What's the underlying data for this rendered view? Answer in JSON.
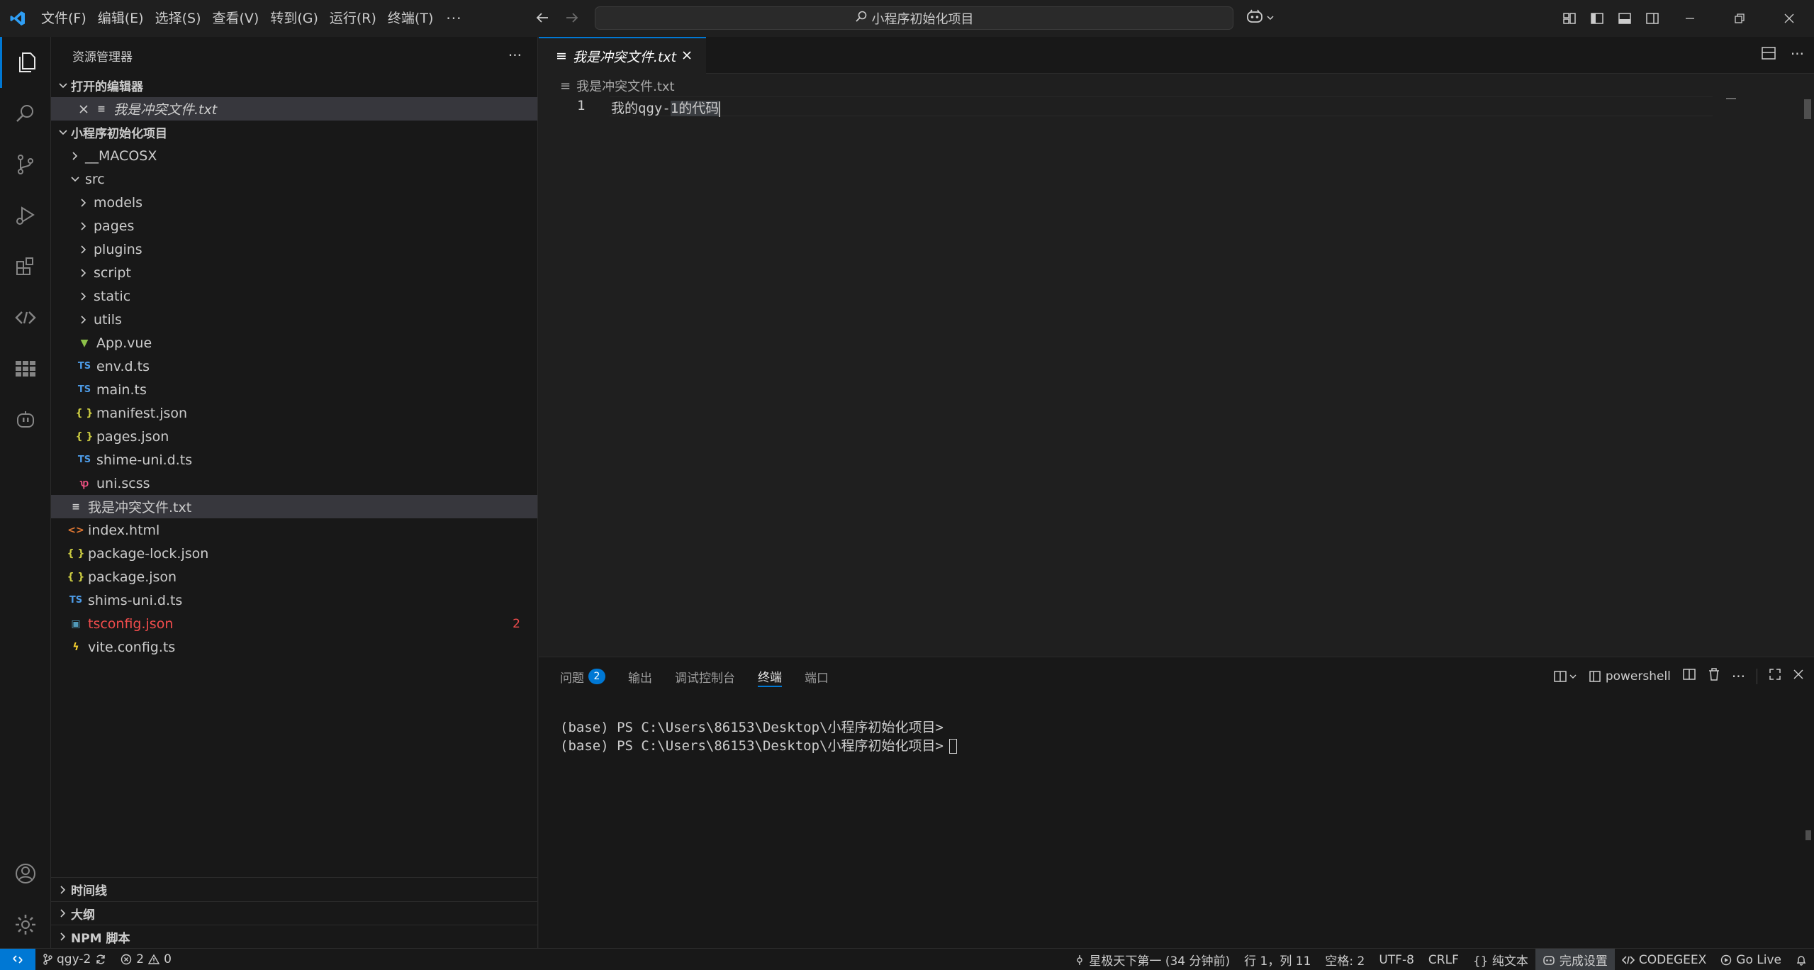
{
  "colors": {
    "accent": "#0078d4",
    "error": "#f14c4c",
    "background": "#1f1f1f",
    "sidebar": "#181818"
  },
  "menu": [
    "文件(F)",
    "编辑(E)",
    "选择(S)",
    "查看(V)",
    "转到(G)",
    "运行(R)",
    "终端(T)"
  ],
  "menu_more": "···",
  "command_center": {
    "text": "小程序初始化项目",
    "icon": "search-icon"
  },
  "sidebar": {
    "title": "资源管理器",
    "more": "···",
    "open_editors": {
      "label": "打开的编辑器",
      "items": [
        {
          "name": "我是冲突文件.txt"
        }
      ]
    },
    "project": {
      "label": "小程序初始化项目",
      "tree": [
        {
          "name": "__MACOSX",
          "type": "folder",
          "indent": 1
        },
        {
          "name": "src",
          "type": "folder-open",
          "indent": 1
        },
        {
          "name": "models",
          "type": "folder",
          "indent": 2
        },
        {
          "name": "pages",
          "type": "folder",
          "indent": 2
        },
        {
          "name": "plugins",
          "type": "folder",
          "indent": 2
        },
        {
          "name": "script",
          "type": "folder",
          "indent": 2
        },
        {
          "name": "static",
          "type": "folder",
          "indent": 2
        },
        {
          "name": "utils",
          "type": "folder",
          "indent": 2
        },
        {
          "name": "App.vue",
          "type": "vue",
          "indent": 2
        },
        {
          "name": "env.d.ts",
          "type": "ts",
          "indent": 2
        },
        {
          "name": "main.ts",
          "type": "ts",
          "indent": 2
        },
        {
          "name": "manifest.json",
          "type": "json",
          "indent": 2
        },
        {
          "name": "pages.json",
          "type": "json",
          "indent": 2
        },
        {
          "name": "shime-uni.d.ts",
          "type": "ts",
          "indent": 2
        },
        {
          "name": "uni.scss",
          "type": "scss",
          "indent": 2
        },
        {
          "name": "我是冲突文件.txt",
          "type": "txt",
          "indent": 1,
          "selected": true
        },
        {
          "name": "index.html",
          "type": "html",
          "indent": 1
        },
        {
          "name": "package-lock.json",
          "type": "json",
          "indent": 1
        },
        {
          "name": "package.json",
          "type": "json",
          "indent": 1
        },
        {
          "name": "shims-uni.d.ts",
          "type": "ts",
          "indent": 1
        },
        {
          "name": "tsconfig.json",
          "type": "tsconfig",
          "indent": 1,
          "errors": "2"
        },
        {
          "name": "vite.config.ts",
          "type": "vite",
          "indent": 1
        }
      ]
    },
    "bottom_sections": [
      "时间线",
      "大纲",
      "NPM 脚本"
    ]
  },
  "editor": {
    "tab": {
      "label": "我是冲突文件.txt"
    },
    "breadcrumb": "我是冲突文件.txt",
    "line_number": "1",
    "code_before": "我的qgy-",
    "code_selected": "1的代码"
  },
  "panel": {
    "tabs": [
      {
        "label": "问题",
        "badge": "2"
      },
      {
        "label": "输出"
      },
      {
        "label": "调试控制台"
      },
      {
        "label": "终端",
        "active": true
      },
      {
        "label": "端口"
      }
    ],
    "shell": "powershell",
    "terminal_lines": [
      "(base) PS C:\\Users\\86153\\Desktop\\小程序初始化项目>",
      "(base) PS C:\\Users\\86153\\Desktop\\小程序初始化项目>"
    ]
  },
  "statusbar": {
    "branch": "qgy-2",
    "errors": "2",
    "warnings": "0",
    "git_blame": "星极天下第一 (34 分钟前)",
    "position": "行 1，列 11",
    "spaces": "空格: 2",
    "encoding": "UTF-8",
    "eol": "CRLF",
    "language": "{} 纯文本",
    "setup": "完成设置",
    "codegeex": "CODEGEEX",
    "golive": "Go Live"
  }
}
